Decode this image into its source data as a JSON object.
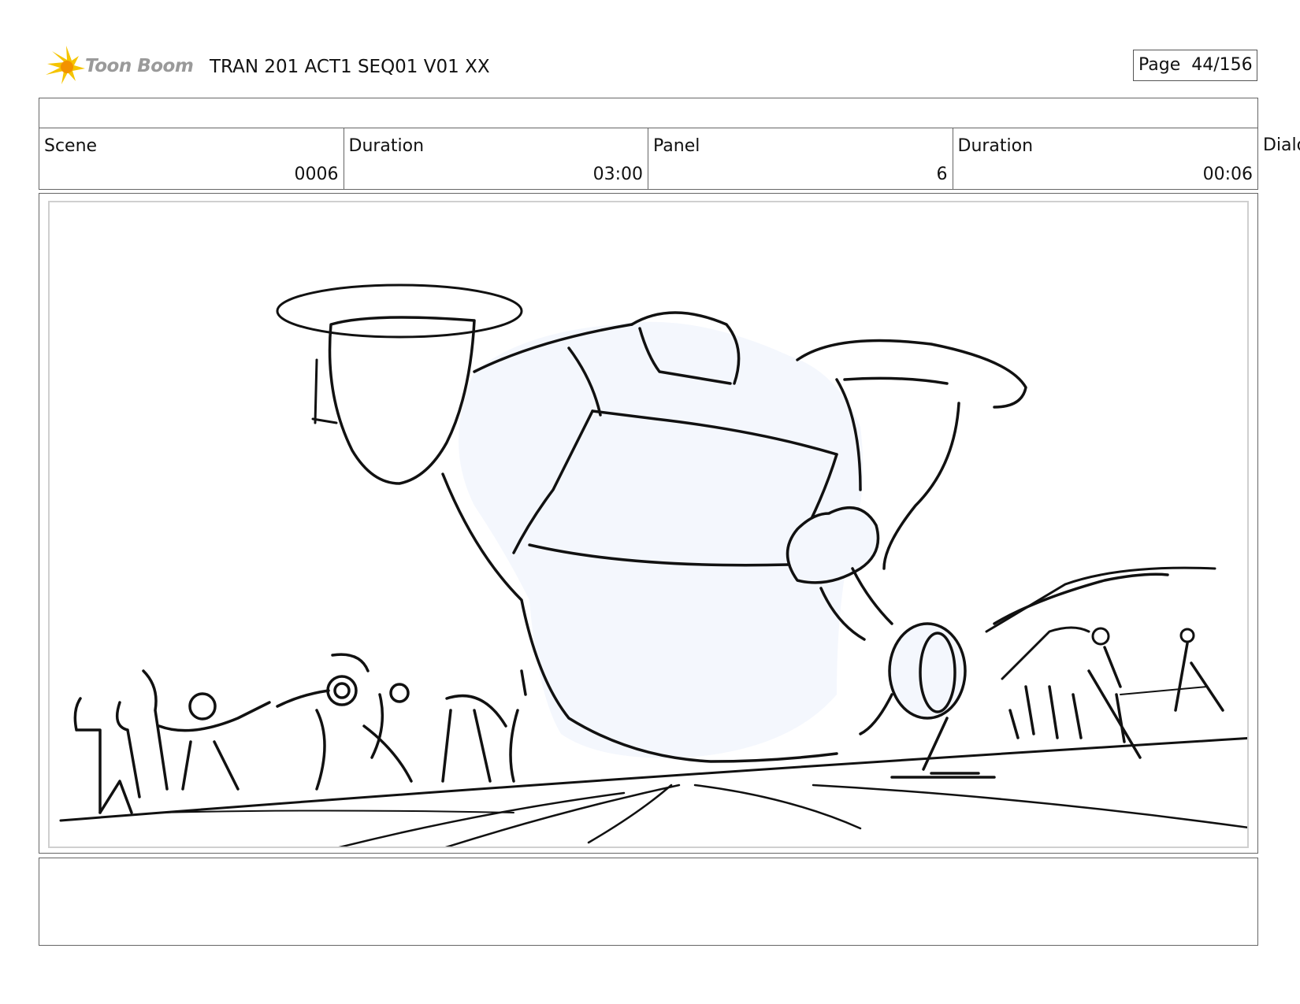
{
  "header": {
    "logo_text": "Toon Boom",
    "doc_title": "TRAN 201 ACT1 SEQ01 V01 XX",
    "page_label": "Page",
    "page_number": "44/156"
  },
  "info": {
    "cells": [
      {
        "label": "Scene",
        "value": "0006"
      },
      {
        "label": "Duration",
        "value": "03:00"
      },
      {
        "label": "Panel",
        "value": "6"
      },
      {
        "label": "Duration",
        "value": "00:06"
      }
    ],
    "overflow_label": "Dialog"
  },
  "colors": {
    "logo_yellow": "#f5c400",
    "logo_orange": "#f39200",
    "border": "#666666",
    "sketch_fill": "#f4f7fd",
    "sketch_stroke": "#111111"
  },
  "icons": {
    "logo": "toon-boom-star-icon"
  }
}
